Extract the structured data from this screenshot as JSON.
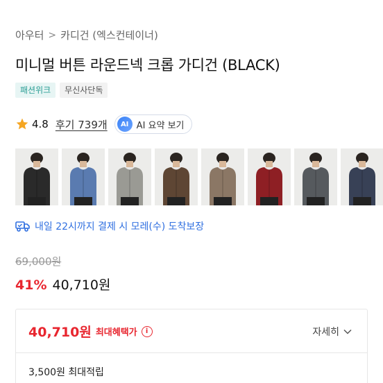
{
  "breadcrumb": {
    "items": [
      "아우터",
      "카디건 (엑스컨테이너)"
    ],
    "separator": ">"
  },
  "product": {
    "title": "미니멀 버튼 라운드넥 크롭 가디건 (BLACK)",
    "tags": [
      "패션위크",
      "무신사단독"
    ]
  },
  "rating": {
    "score": "4.8",
    "reviews": "후기 739개",
    "ai_badge": "AI",
    "ai_label": "AI 요약 보기"
  },
  "thumbnails": [
    {
      "color": "#2a2a2a",
      "selected": true
    },
    {
      "color": "#5a7bb0",
      "selected": false
    },
    {
      "color": "#9a9a94",
      "selected": false
    },
    {
      "color": "#5e4634",
      "selected": false
    },
    {
      "color": "#8b7765",
      "selected": false
    },
    {
      "color": "#8e1f24",
      "selected": false
    },
    {
      "color": "#565a5e",
      "selected": false
    },
    {
      "color": "#384156",
      "selected": false
    }
  ],
  "delivery": {
    "text": "내일 22시까지 결제 시 모레(수) 도착보장"
  },
  "pricing": {
    "original": "69,000원",
    "discount": "41%",
    "price": "40,710원"
  },
  "benefit": {
    "price": "40,710원",
    "label": "최대혜택가",
    "info_icon": "i",
    "detail": "자세히",
    "points": "3,500원 최대적립"
  },
  "colors": {
    "accent_red": "#e8262f",
    "delivery_blue": "#2f6fe0",
    "tag_teal": "#2a9d94"
  }
}
